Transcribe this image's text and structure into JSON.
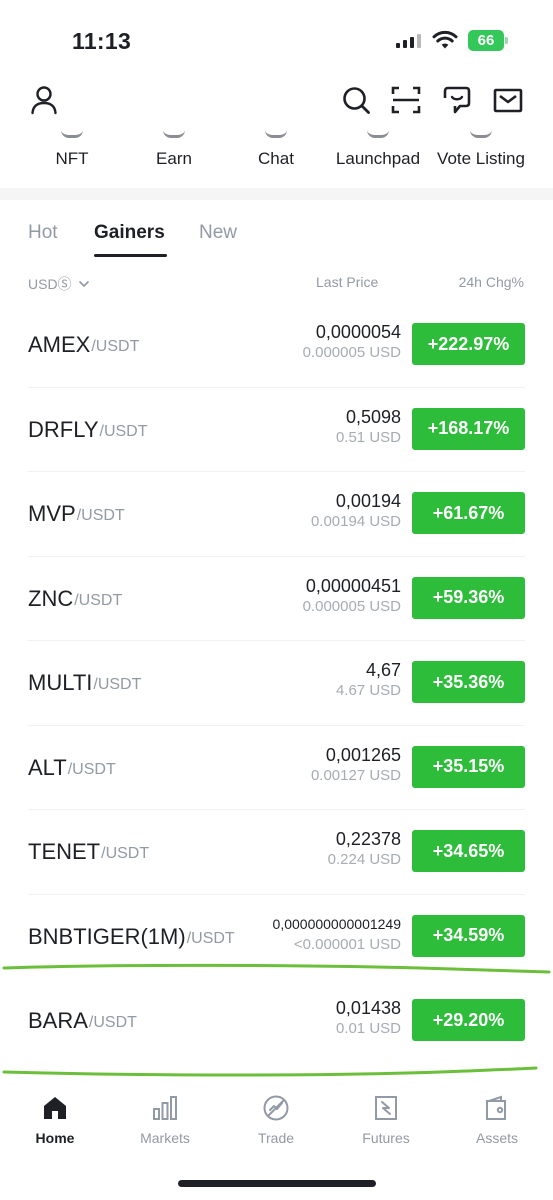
{
  "status_bar": {
    "time": "11:13",
    "battery": "66"
  },
  "quick_nav": [
    {
      "label": "NFT"
    },
    {
      "label": "Earn"
    },
    {
      "label": "Chat"
    },
    {
      "label": "Launchpad"
    },
    {
      "label": "Vote Listing"
    }
  ],
  "tabs": [
    {
      "label": "Hot"
    },
    {
      "label": "Gainers"
    },
    {
      "label": "New"
    }
  ],
  "active_tab": "Gainers",
  "columns": {
    "quote_selector": "USDⓈ",
    "last_price": "Last Price",
    "change": "24h Chg%"
  },
  "rows": [
    {
      "base": "AMEX",
      "quote": "/USDT",
      "price": "0,0000054",
      "usd": "0.000005 USD",
      "change": "+222.97%"
    },
    {
      "base": "DRFLY",
      "quote": "/USDT",
      "price": "0,5098",
      "usd": "0.51 USD",
      "change": "+168.17%"
    },
    {
      "base": "MVP",
      "quote": "/USDT",
      "price": "0,00194",
      "usd": "0.00194 USD",
      "change": "+61.67%"
    },
    {
      "base": "ZNC",
      "quote": "/USDT",
      "price": "0,00000451",
      "usd": "0.000005 USD",
      "change": "+59.36%"
    },
    {
      "base": "MULTI",
      "quote": "/USDT",
      "price": "4,67",
      "usd": "4.67 USD",
      "change": "+35.36%"
    },
    {
      "base": "ALT",
      "quote": "/USDT",
      "price": "0,001265",
      "usd": "0.00127 USD",
      "change": "+35.15%"
    },
    {
      "base": "TENET",
      "quote": "/USDT",
      "price": "0,22378",
      "usd": "0.224 USD",
      "change": "+34.65%"
    },
    {
      "base": "BNBTIGER(1M)",
      "quote": "/USDT",
      "price": "0,000000000001249",
      "usd": "<0.000001 USD",
      "change": "+34.59%"
    },
    {
      "base": "BARA",
      "quote": "/USDT",
      "price": "0,01438",
      "usd": "0.01 USD",
      "change": "+29.20%"
    }
  ],
  "bottom_nav": [
    {
      "label": "Home"
    },
    {
      "label": "Markets"
    },
    {
      "label": "Trade"
    },
    {
      "label": "Futures"
    },
    {
      "label": "Assets"
    }
  ],
  "colors": {
    "up": "#2ebd3b",
    "text": "#1e2026",
    "muted": "#929aa5",
    "marker": "#6cbf3a"
  }
}
